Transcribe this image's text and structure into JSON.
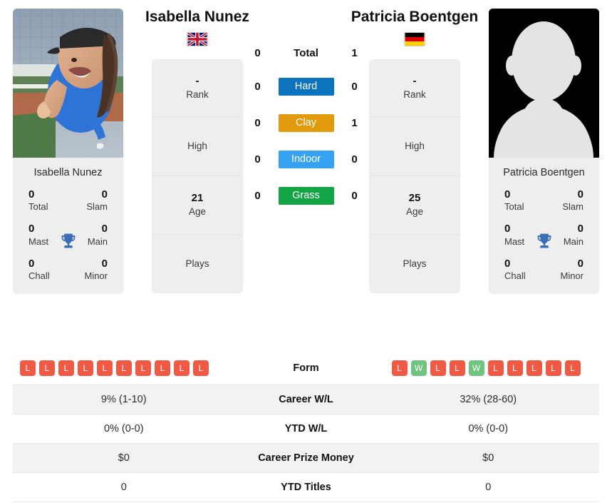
{
  "players": {
    "left": {
      "name": "Isabella Nunez",
      "caption": "Isabella Nunez",
      "flag": "gb-flag",
      "rank": "-",
      "rank_label": "Rank",
      "high_value": "",
      "high_label": "High",
      "age": "21",
      "age_label": "Age",
      "plays_value": "",
      "plays_label": "Plays",
      "titles": {
        "total_value": "0",
        "total_label": "Total",
        "slam_value": "0",
        "slam_label": "Slam",
        "mast_value": "0",
        "mast_label": "Mast",
        "main_value": "0",
        "main_label": "Main",
        "chall_value": "0",
        "chall_label": "Chall",
        "minor_value": "0",
        "minor_label": "Minor"
      },
      "form": [
        "L",
        "L",
        "L",
        "L",
        "L",
        "L",
        "L",
        "L",
        "L",
        "L"
      ],
      "career_wl": "9% (1-10)",
      "ytd_wl": "0% (0-0)",
      "career_prize_money": "$0",
      "ytd_titles": "0"
    },
    "right": {
      "name": "Patricia Boentgen",
      "caption": "Patricia Boentgen",
      "flag": "de-flag",
      "rank": "-",
      "rank_label": "Rank",
      "high_value": "",
      "high_label": "High",
      "age": "25",
      "age_label": "Age",
      "plays_value": "",
      "plays_label": "Plays",
      "titles": {
        "total_value": "0",
        "total_label": "Total",
        "slam_value": "0",
        "slam_label": "Slam",
        "mast_value": "0",
        "mast_label": "Mast",
        "main_value": "0",
        "main_label": "Main",
        "chall_value": "0",
        "chall_label": "Chall",
        "minor_value": "0",
        "minor_label": "Minor"
      },
      "form": [
        "L",
        "W",
        "L",
        "L",
        "W",
        "L",
        "L",
        "L",
        "L",
        "L"
      ],
      "career_wl": "32% (28-60)",
      "ytd_wl": "0% (0-0)",
      "career_prize_money": "$0",
      "ytd_titles": "0"
    }
  },
  "h2h": {
    "rows": [
      {
        "label": "Total",
        "left": "0",
        "right": "1",
        "badge": false,
        "color": ""
      },
      {
        "label": "Hard",
        "left": "0",
        "right": "0",
        "badge": true,
        "color": "#0c73bf"
      },
      {
        "label": "Clay",
        "left": "0",
        "right": "1",
        "badge": true,
        "color": "#e09a0c"
      },
      {
        "label": "Indoor",
        "left": "0",
        "right": "0",
        "badge": true,
        "color": "#35a3f2"
      },
      {
        "label": "Grass",
        "left": "0",
        "right": "0",
        "badge": true,
        "color": "#13a544"
      }
    ]
  },
  "table": {
    "rows": [
      {
        "label": "Form"
      },
      {
        "label": "Career W/L"
      },
      {
        "label": "YTD W/L"
      },
      {
        "label": "Career Prize Money"
      },
      {
        "label": "YTD Titles"
      }
    ]
  },
  "colors": {
    "hard": "#0c73bf",
    "clay": "#e09a0c",
    "indoor": "#35a3f2",
    "grass": "#13a544",
    "loss": "#f05a45",
    "win": "#6fc47f",
    "trophy": "#3b6fb5",
    "card_bg": "#eeeeee"
  }
}
